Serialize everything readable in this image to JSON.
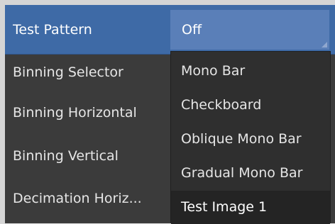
{
  "properties": {
    "rows": [
      {
        "label": "Test Pattern"
      },
      {
        "label": "Binning Selector"
      },
      {
        "label": "Binning Horizontal"
      },
      {
        "label": "Binning Vertical"
      },
      {
        "label": "Decimation Horiz..."
      }
    ],
    "selected_value": "Off"
  },
  "dropdown": {
    "options": [
      "Mono Bar",
      "Checkboard",
      "Oblique Mono Bar",
      "Gradual Mono Bar",
      "Test Image 1"
    ]
  },
  "colors": {
    "selected_row": "#3e6aa6",
    "value_box": "#5a7fb8",
    "panel_bg": "#3b3b3b",
    "dropdown_bg": "#2f2f2f"
  }
}
